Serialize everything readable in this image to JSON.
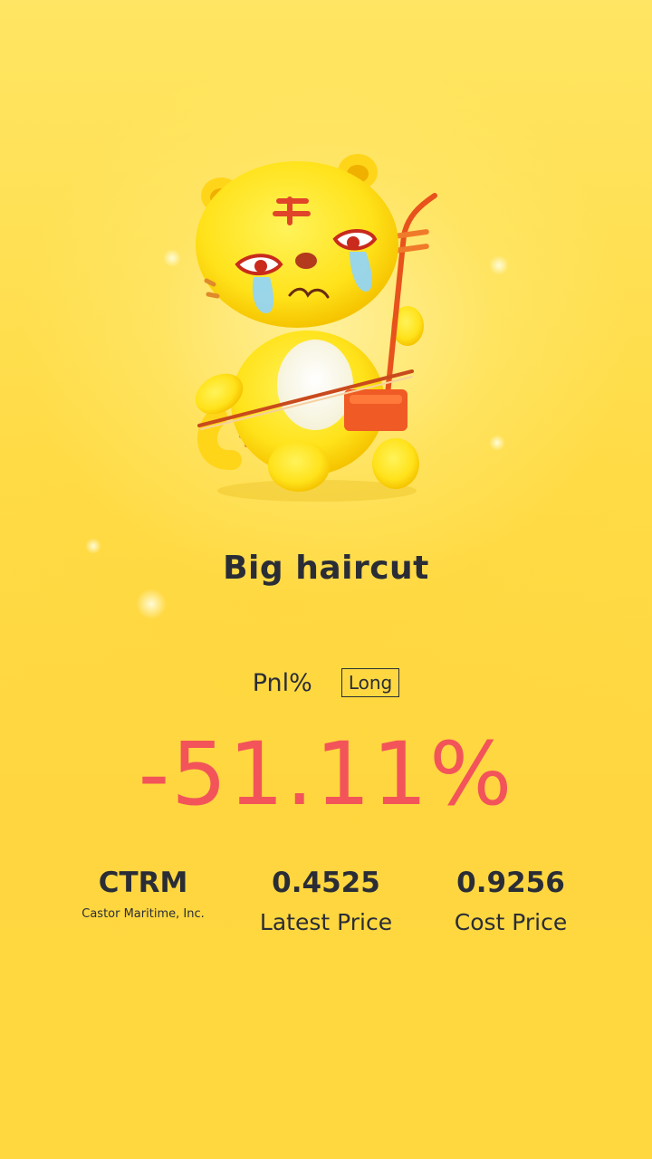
{
  "hero": {
    "illustration": "crying-tiger-playing-erhu"
  },
  "headline": "Big haircut",
  "pnl": {
    "label": "Pnl%",
    "direction_badge": "Long",
    "value": "-51.11%",
    "value_color": "#f2545a"
  },
  "stats": {
    "symbol": "CTRM",
    "company_name": "Castor Maritime, Inc.",
    "latest_price": "0.4525",
    "latest_price_label": "Latest Price",
    "cost_price": "0.9256",
    "cost_price_label": "Cost Price"
  },
  "colors": {
    "background": "#ffd83f",
    "text": "#2a2d36",
    "loss": "#f2545a"
  }
}
